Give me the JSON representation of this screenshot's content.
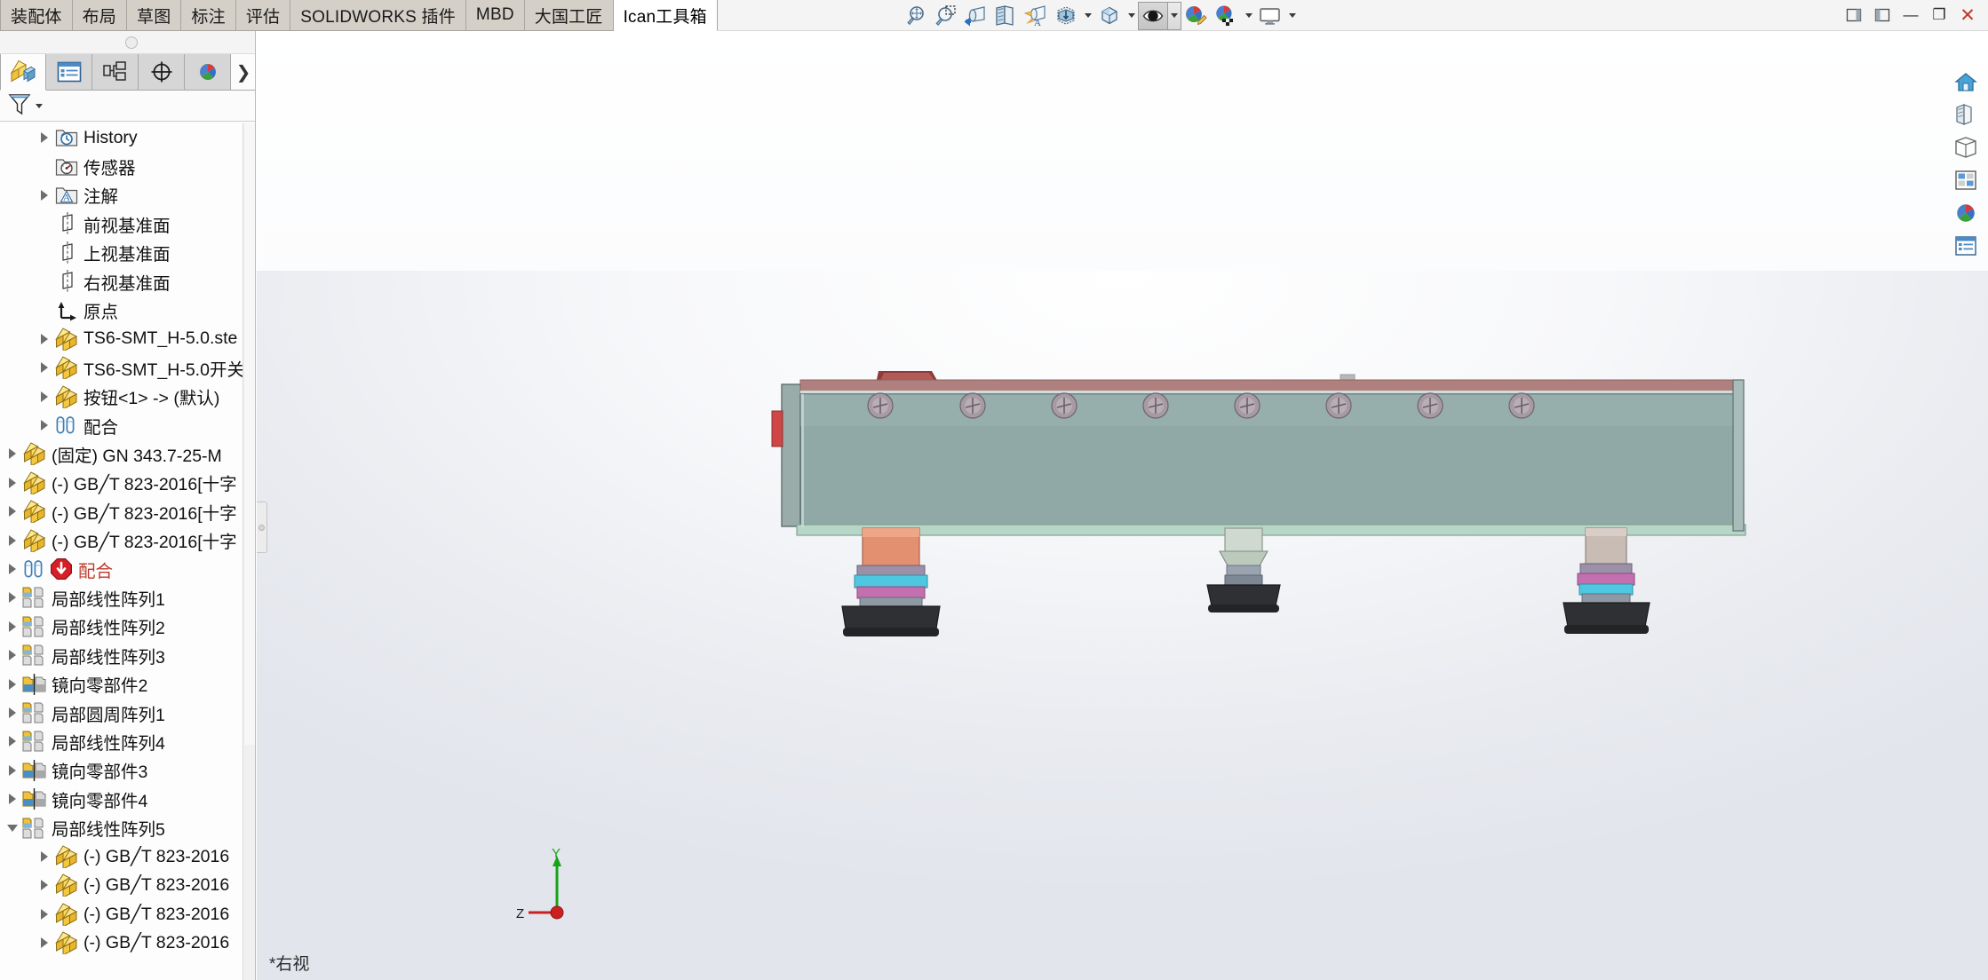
{
  "ribbon": {
    "tabs": [
      {
        "label": "装配体",
        "active": false
      },
      {
        "label": "布局",
        "active": false
      },
      {
        "label": "草图",
        "active": false
      },
      {
        "label": "标注",
        "active": false
      },
      {
        "label": "评估",
        "active": false
      },
      {
        "label": "SOLIDWORKS 插件",
        "active": false
      },
      {
        "label": "MBD",
        "active": false
      },
      {
        "label": "大国工匠",
        "active": false
      },
      {
        "label": "Ican工具箱",
        "active": true
      }
    ]
  },
  "view_toolbar": {
    "buttons": [
      {
        "name": "zoom-to-fit-icon",
        "tooltip": "整屏显示全图"
      },
      {
        "name": "zoom-to-area-icon",
        "tooltip": "局部放大"
      },
      {
        "name": "previous-view-icon",
        "tooltip": "上一视图"
      },
      {
        "name": "section-view-icon",
        "tooltip": "剖面视图"
      },
      {
        "name": "view-orientation-icon",
        "tooltip": "视图定向"
      },
      {
        "name": "display-style-icon",
        "tooltip": "显示样式"
      },
      {
        "name": "hide-show-items-icon",
        "tooltip": "隐藏/显示项目"
      },
      {
        "name": "edit-appearance-icon",
        "tooltip": "编辑外观"
      },
      {
        "name": "apply-scene-icon",
        "tooltip": "应用布景"
      },
      {
        "name": "view-settings-icon",
        "tooltip": "视图设定"
      }
    ]
  },
  "window_controls": {
    "restore_panel_label": "▣",
    "pin_label": "▢",
    "minimize_label": "—",
    "maximize_label": "❐",
    "close_label": "✕"
  },
  "left_panel": {
    "tabs": [
      {
        "name": "feature-manager-tab",
        "label": "FeatureManager 设计树",
        "active": true
      },
      {
        "name": "property-manager-tab",
        "label": "PropertyManager",
        "active": false
      },
      {
        "name": "configuration-manager-tab",
        "label": "ConfigurationManager",
        "active": false
      },
      {
        "name": "dimxpert-manager-tab",
        "label": "DimXpertManager",
        "active": false
      },
      {
        "name": "display-manager-tab",
        "label": "DisplayManager",
        "active": false
      }
    ],
    "expand_label": "❯",
    "filter_placeholder": "过滤",
    "tree": [
      {
        "label": "History",
        "icon": "history-folder-icon",
        "indent": 1,
        "arrow": "collapsed",
        "error": false
      },
      {
        "label": "传感器",
        "icon": "sensor-folder-icon",
        "indent": 1,
        "arrow": "none",
        "error": false
      },
      {
        "label": "注解",
        "icon": "annotation-folder-icon",
        "indent": 1,
        "arrow": "collapsed",
        "error": false
      },
      {
        "label": "前视基准面",
        "icon": "plane-icon",
        "indent": 1,
        "arrow": "none",
        "error": false
      },
      {
        "label": "上视基准面",
        "icon": "plane-icon",
        "indent": 1,
        "arrow": "none",
        "error": false
      },
      {
        "label": "右视基准面",
        "icon": "plane-icon",
        "indent": 1,
        "arrow": "none",
        "error": false
      },
      {
        "label": "原点",
        "icon": "origin-icon",
        "indent": 1,
        "arrow": "none",
        "error": false
      },
      {
        "label": "TS6-SMT_H-5.0.ste",
        "icon": "part-icon",
        "indent": 1,
        "arrow": "collapsed",
        "error": false
      },
      {
        "label": "TS6-SMT_H-5.0开关",
        "icon": "part-icon",
        "indent": 1,
        "arrow": "collapsed",
        "error": false
      },
      {
        "label": "按钮<1> -> (默认)",
        "icon": "part-icon",
        "indent": 1,
        "arrow": "collapsed",
        "error": false
      },
      {
        "label": "配合",
        "icon": "mates-icon",
        "indent": 1,
        "arrow": "collapsed",
        "error": false
      },
      {
        "label": "(固定) GN 343.7-25-M",
        "icon": "part-icon",
        "indent": 0,
        "arrow": "collapsed",
        "error": false
      },
      {
        "label": "(-) GB╱T 823-2016[十字",
        "icon": "part-icon",
        "indent": 0,
        "arrow": "collapsed",
        "error": false
      },
      {
        "label": "(-) GB╱T 823-2016[十字",
        "icon": "part-icon",
        "indent": 0,
        "arrow": "collapsed",
        "error": false
      },
      {
        "label": "(-) GB╱T 823-2016[十字",
        "icon": "part-icon",
        "indent": 0,
        "arrow": "collapsed",
        "error": false
      },
      {
        "label": "配合",
        "icon": "mates-icon",
        "indent": 0,
        "arrow": "collapsed",
        "error": true
      },
      {
        "label": "局部线性阵列1",
        "icon": "local-pattern-icon",
        "indent": 0,
        "arrow": "collapsed",
        "error": false
      },
      {
        "label": "局部线性阵列2",
        "icon": "local-pattern-icon",
        "indent": 0,
        "arrow": "collapsed",
        "error": false
      },
      {
        "label": "局部线性阵列3",
        "icon": "local-pattern-icon",
        "indent": 0,
        "arrow": "collapsed",
        "error": false
      },
      {
        "label": "镜向零部件2",
        "icon": "mirror-component-icon",
        "indent": 0,
        "arrow": "collapsed",
        "error": false
      },
      {
        "label": "局部圆周阵列1",
        "icon": "local-pattern-icon",
        "indent": 0,
        "arrow": "collapsed",
        "error": false
      },
      {
        "label": "局部线性阵列4",
        "icon": "local-pattern-icon",
        "indent": 0,
        "arrow": "collapsed",
        "error": false
      },
      {
        "label": "镜向零部件3",
        "icon": "mirror-component-icon",
        "indent": 0,
        "arrow": "collapsed",
        "error": false
      },
      {
        "label": "镜向零部件4",
        "icon": "mirror-component-icon",
        "indent": 0,
        "arrow": "collapsed",
        "error": false
      },
      {
        "label": "局部线性阵列5",
        "icon": "local-pattern-icon",
        "indent": 0,
        "arrow": "expanded",
        "error": false
      },
      {
        "label": "(-) GB╱T 823-2016",
        "icon": "part-icon",
        "indent": 1,
        "arrow": "collapsed",
        "error": false
      },
      {
        "label": "(-) GB╱T 823-2016",
        "icon": "part-icon",
        "indent": 1,
        "arrow": "collapsed",
        "error": false
      },
      {
        "label": "(-) GB╱T 823-2016",
        "icon": "part-icon",
        "indent": 1,
        "arrow": "collapsed",
        "error": false
      },
      {
        "label": "(-) GB╱T 823-2016",
        "icon": "part-icon",
        "indent": 1,
        "arrow": "collapsed",
        "error": false
      }
    ]
  },
  "viewport": {
    "status_text": "*右视",
    "triad": {
      "y_label": "Y",
      "z_label": "Z"
    },
    "right_toolbar": [
      {
        "name": "view-home-icon",
        "tooltip": "主视图"
      },
      {
        "name": "view-orientation-icon",
        "tooltip": "视图定向"
      },
      {
        "name": "view-display-icon",
        "tooltip": "显示样式"
      },
      {
        "name": "view-section-icon",
        "tooltip": "剖面视图"
      },
      {
        "name": "view-appearance-icon",
        "tooltip": "外观"
      },
      {
        "name": "view-scene-icon",
        "tooltip": "布景"
      }
    ]
  },
  "colors": {
    "tab_active_bg": "#ffffff",
    "tab_bg": "#d4d0c8",
    "beam_body": "#8fa8a6",
    "beam_top_edge": "#b3807e",
    "error_red": "#c0392b",
    "axis_green": "#19a319",
    "axis_red": "#cc2020",
    "part_yellow": "#f5c63c"
  }
}
